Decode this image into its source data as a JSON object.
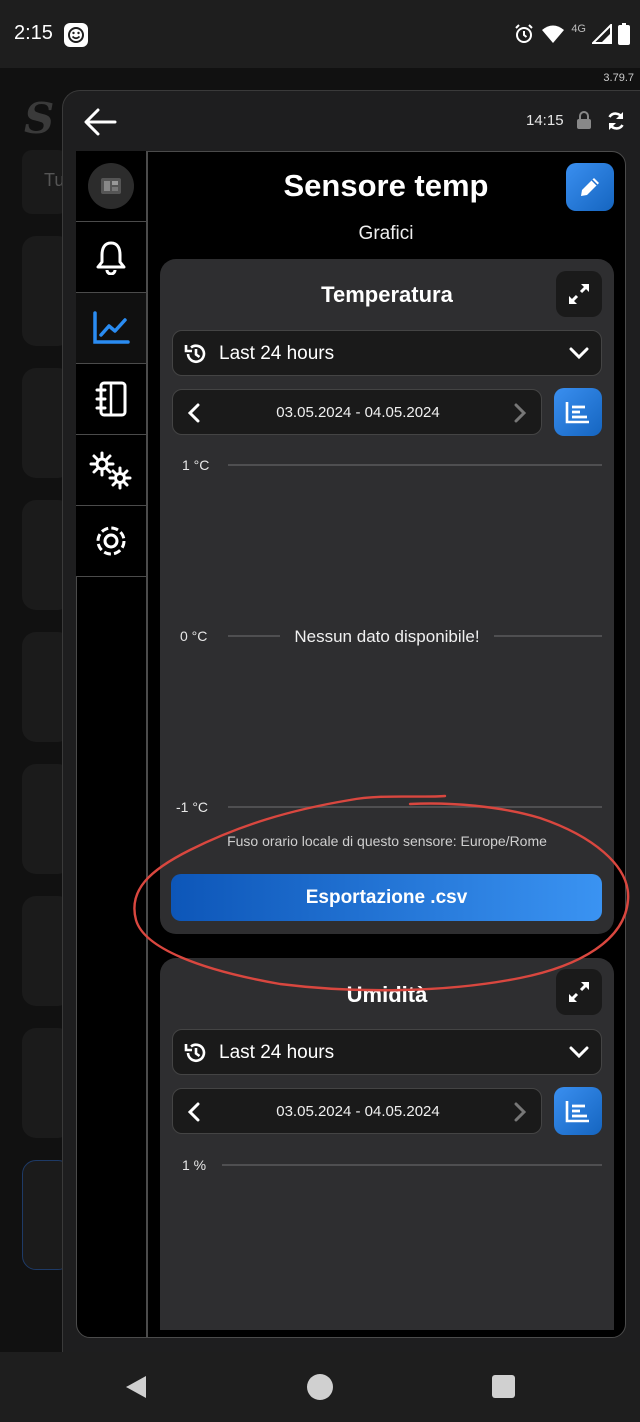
{
  "statusbar": {
    "time": "2:15",
    "network": "4G"
  },
  "app": {
    "version": "3.79.7",
    "ghost_tab_label": "Tu"
  },
  "dialog": {
    "time": "14:15",
    "title": "Sensore temp",
    "subtitle": "Grafici"
  },
  "sidebar": {
    "items": [
      {
        "icon": "sensor-avatar-icon"
      },
      {
        "icon": "bell-icon"
      },
      {
        "icon": "chart-line-icon",
        "active": true
      },
      {
        "icon": "notebook-icon"
      },
      {
        "icon": "gears-icon"
      },
      {
        "icon": "gear-icon"
      }
    ]
  },
  "cards": [
    {
      "title": "Temperatura",
      "period_label": "Last 24 hours",
      "date_range": "03.05.2024 - 04.05.2024",
      "no_data_message": "Nessun dato disponibile!",
      "timezone_note": "Fuso orario locale di questo sensore: Europe/Rome",
      "export_label": "Esportazione .csv"
    },
    {
      "title": "Umidità",
      "period_label": "Last 24 hours",
      "date_range": "03.05.2024 - 04.05.2024"
    }
  ],
  "chart_data": [
    {
      "type": "line",
      "title": "Temperatura",
      "y_ticks": [
        "1 °C",
        "0 °C",
        "-1 °C"
      ],
      "ylim": [
        -1,
        1
      ],
      "series": [],
      "grid": true
    },
    {
      "type": "line",
      "title": "Umidità",
      "y_ticks": [
        "1 %"
      ],
      "series": [],
      "grid": true
    }
  ],
  "colors": {
    "accent": "#1e88e5",
    "card_bg": "#2e2e30",
    "annotation": "#d9473f"
  }
}
